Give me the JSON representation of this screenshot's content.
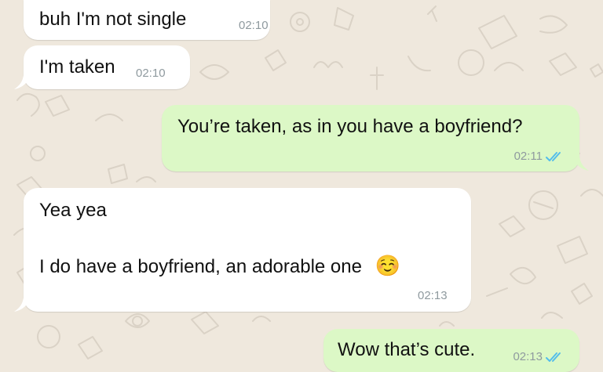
{
  "chat": {
    "messages": [
      {
        "direction": "incoming",
        "text": "buh I'm not single",
        "time": "02:10"
      },
      {
        "direction": "incoming",
        "text": "I'm taken",
        "time": "02:10"
      },
      {
        "direction": "outgoing",
        "text": "You’re taken, as in you have a boyfriend?",
        "time": "02:11",
        "status": "read"
      },
      {
        "direction": "incoming",
        "lines": [
          "Yea yea",
          "I do have a boyfriend, an adorable one"
        ],
        "emoji": "☺️",
        "time": "02:13"
      },
      {
        "direction": "outgoing",
        "text": "Wow that’s cute.",
        "time": "02:13",
        "status": "read"
      }
    ]
  },
  "colors": {
    "wallpaper": "#efe8dd",
    "incoming_bubble": "#ffffff",
    "outgoing_bubble": "#dcf8c6",
    "timestamp": "#8f9a9f",
    "read_ticks": "#53bdeb"
  },
  "icons": {
    "read_receipt": "double-check-icon",
    "wallpaper_doodles": "doodle-pattern"
  }
}
